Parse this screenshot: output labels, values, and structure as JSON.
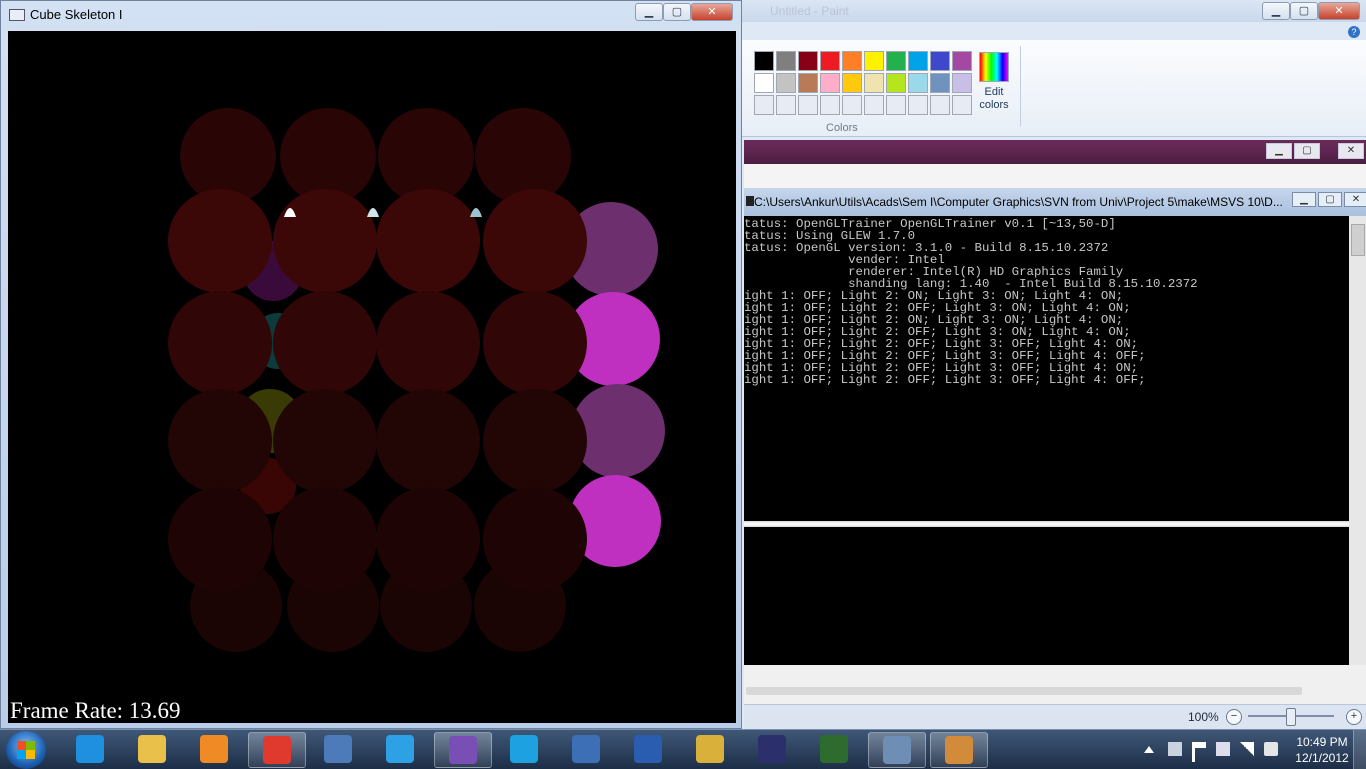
{
  "paint": {
    "title_ghost": "Untitled - Paint",
    "help_label": "?",
    "colors_label": "Colors",
    "edit_colors_label": "Edit colors",
    "palette_row1": [
      "#000000",
      "#7f7f7f",
      "#880015",
      "#ed1c24",
      "#ff7f27",
      "#fff200",
      "#22b14c",
      "#00a2e8",
      "#3f48cc",
      "#a349a4"
    ],
    "palette_row2": [
      "#ffffff",
      "#c3c3c3",
      "#b97a57",
      "#ffaec9",
      "#ffc90e",
      "#efe4b0",
      "#b5e61d",
      "#99d9ea",
      "#7092be",
      "#c8bfe7"
    ],
    "palette_row3": [
      "#e7ecf4",
      "#e7ecf4",
      "#e7ecf4",
      "#e7ecf4",
      "#e7ecf4",
      "#e7ecf4",
      "#e7ecf4",
      "#e7ecf4",
      "#e7ecf4",
      "#e7ecf4"
    ],
    "zoom": "100%",
    "zoom_minus": "−",
    "zoom_plus": "+",
    "minimize_glyph": "▁",
    "maximize_glyph": "▢",
    "close_glyph": "✕"
  },
  "console": {
    "title_path": "C:\\Users\\Ankur\\Utils\\Acads\\Sem I\\Computer Graphics\\SVN from Univ\\Project 5\\make\\MSVS 10\\D...",
    "lines": [
      "tatus: OpenGLTrainer OpenGLTrainer v0.1 [~13,50-D]",
      "tatus: Using GLEW 1.7.0",
      "tatus: OpenGL version: 3.1.0 - Build 8.15.10.2372",
      "              vender: Intel",
      "              renderer: Intel(R) HD Graphics Family",
      "              shanding lang: 1.40  - Intel Build 8.15.10.2372",
      "ight 1: OFF; Light 2: ON; Light 3: ON; Light 4: ON;",
      "ight 1: OFF; Light 2: OFF; Light 3: ON; Light 4: ON;",
      "ight 1: OFF; Light 2: ON; Light 3: ON; Light 4: ON;",
      "ight 1: OFF; Light 2: OFF; Light 3: ON; Light 4: ON;",
      "ight 1: OFF; Light 2: OFF; Light 3: OFF; Light 4: ON;",
      "ight 1: OFF; Light 2: OFF; Light 3: OFF; Light 4: OFF;",
      "ight 1: OFF; Light 2: OFF; Light 3: OFF; Light 4: ON;",
      "ight 1: OFF; Light 2: OFF; Light 3: OFF; Light 4: OFF;"
    ]
  },
  "gl_window": {
    "title": "Cube Skeleton I",
    "frame_rate": "Frame Rate: 13.69"
  },
  "taskbar": {
    "time": "10:49 PM",
    "date": "12/1/2012",
    "apps": [
      {
        "name": "internet-explorer",
        "color": "#1f8fe0"
      },
      {
        "name": "windows-explorer",
        "color": "#e9c04a"
      },
      {
        "name": "media-player",
        "color": "#f08a24"
      },
      {
        "name": "chrome",
        "color": "#e03a2f"
      },
      {
        "name": "text-editor",
        "color": "#4d7ab8"
      },
      {
        "name": "twitter",
        "color": "#2ea0e6"
      },
      {
        "name": "visual-studio",
        "color": "#7a4fb5"
      },
      {
        "name": "skype",
        "color": "#1ea1e0"
      },
      {
        "name": "thunderbird",
        "color": "#3c6fb5"
      },
      {
        "name": "word",
        "color": "#2a5db0"
      },
      {
        "name": "counter-strike",
        "color": "#d9b13a"
      },
      {
        "name": "eclipse",
        "color": "#2b2f6b"
      },
      {
        "name": "console",
        "color": "#2e6b2e"
      },
      {
        "name": "paint-window",
        "color": "#6f8eb5"
      },
      {
        "name": "paint",
        "color": "#d28a3b"
      }
    ]
  }
}
